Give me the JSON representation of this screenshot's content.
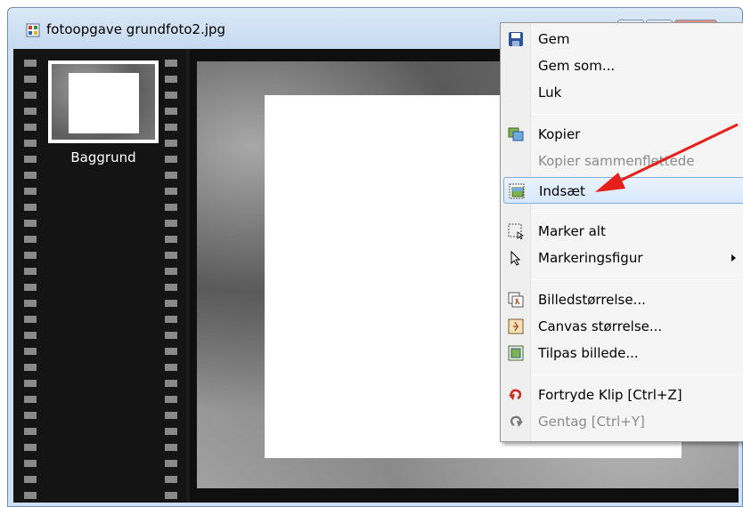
{
  "window": {
    "title": "fotoopgave grundfoto2.jpg"
  },
  "layers": [
    {
      "label": "Baggrund"
    }
  ],
  "context_menu": {
    "items": [
      {
        "label": "Gem",
        "icon": "floppy-disk-icon",
        "disabled": false
      },
      {
        "label": "Gem som...",
        "icon": "",
        "disabled": false
      },
      {
        "label": "Luk",
        "icon": "",
        "disabled": false
      },
      {
        "label": "Kopier",
        "icon": "copy-image-icon",
        "disabled": false
      },
      {
        "label": "Kopier sammenflettede",
        "icon": "",
        "disabled": true
      },
      {
        "label": "Indsæt",
        "icon": "paste-image-icon",
        "disabled": false,
        "highlighted": true
      },
      {
        "label": "Marker alt",
        "icon": "select-all-icon",
        "disabled": false
      },
      {
        "label": "Markeringsfigur",
        "icon": "selection-cursor-icon",
        "disabled": false,
        "submenu": true
      },
      {
        "label": "Billedstørrelse...",
        "icon": "image-size-icon",
        "disabled": false
      },
      {
        "label": "Canvas størrelse...",
        "icon": "canvas-size-icon",
        "disabled": false
      },
      {
        "label": "Tilpas billede...",
        "icon": "fit-image-icon",
        "disabled": false
      },
      {
        "label": "Fortryde Klip [Ctrl+Z]",
        "icon": "undo-icon",
        "disabled": false
      },
      {
        "label": "Gentag [Ctrl+Y]",
        "icon": "redo-icon",
        "disabled": true
      }
    ]
  },
  "colors": {
    "highlight": "#d6e8fb",
    "annotation_arrow": "#e8201b",
    "undo_icon": "#d42a1f"
  }
}
